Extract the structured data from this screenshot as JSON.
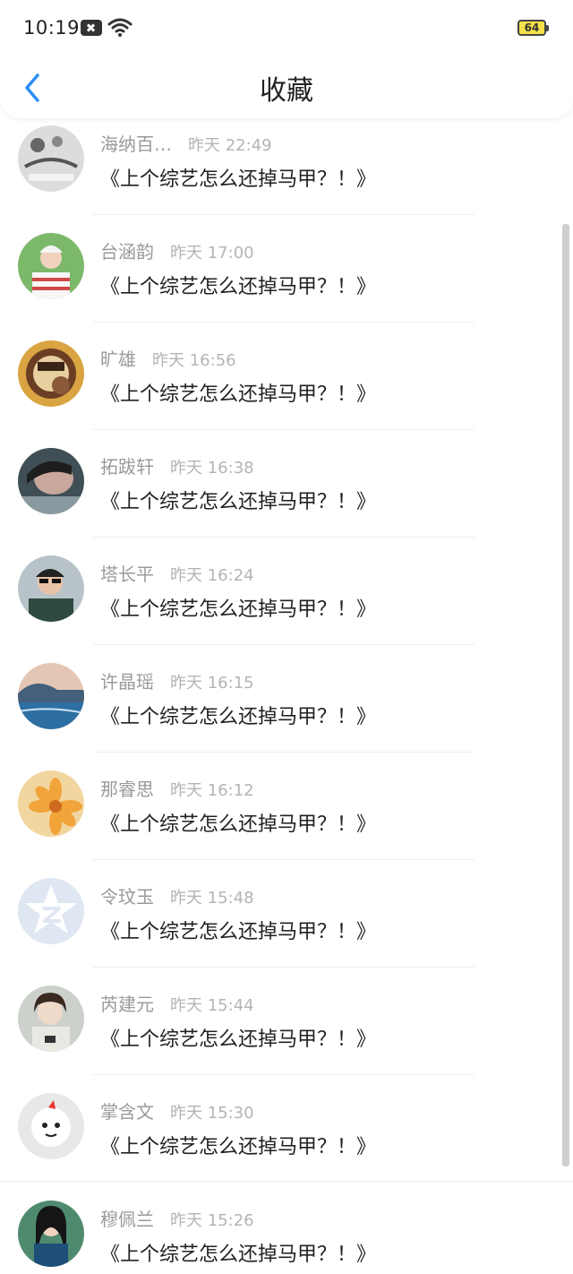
{
  "status_bar": {
    "time": "10:19",
    "battery": "64"
  },
  "header": {
    "title": "收藏"
  },
  "colors": {
    "accent": "#2c8ef8",
    "name": "#9a9a9a",
    "time": "#b4b4b4",
    "title": "#222222"
  },
  "items": [
    {
      "name": "海纳百…",
      "time": "昨天 22:49",
      "title": "《上个综艺怎么还掉马甲？！》"
    },
    {
      "name": "台涵韵",
      "time": "昨天 17:00",
      "title": "《上个综艺怎么还掉马甲？！》"
    },
    {
      "name": "旷雄",
      "time": "昨天 16:56",
      "title": "《上个综艺怎么还掉马甲？！》"
    },
    {
      "name": "拓跋轩",
      "time": "昨天 16:38",
      "title": "《上个综艺怎么还掉马甲？！》"
    },
    {
      "name": "塔长平",
      "time": "昨天 16:24",
      "title": "《上个综艺怎么还掉马甲？！》"
    },
    {
      "name": "许晶瑶",
      "time": "昨天 16:15",
      "title": "《上个综艺怎么还掉马甲？！》"
    },
    {
      "name": "那睿思",
      "time": "昨天 16:12",
      "title": "《上个综艺怎么还掉马甲？！》"
    },
    {
      "name": "令玟玉",
      "time": "昨天 15:48",
      "title": "《上个综艺怎么还掉马甲？！》"
    },
    {
      "name": "芮建元",
      "time": "昨天 15:44",
      "title": "《上个综艺怎么还掉马甲？！》"
    },
    {
      "name": "掌含文",
      "time": "昨天 15:30",
      "title": "《上个综艺怎么还掉马甲？！》"
    },
    {
      "name": "穆佩兰",
      "time": "昨天 15:26",
      "title": "《上个综艺怎么还掉马甲？！》"
    }
  ]
}
